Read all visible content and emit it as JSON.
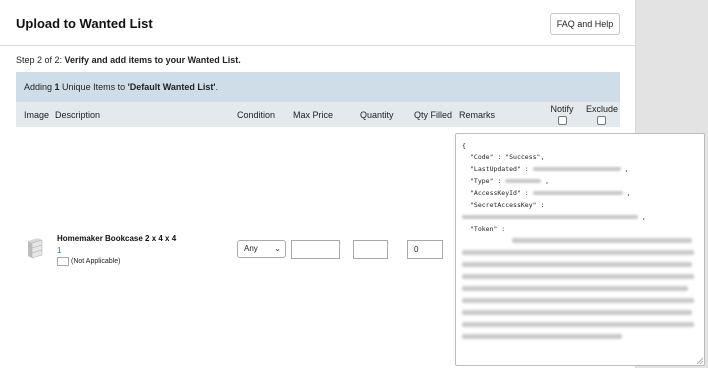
{
  "header": {
    "title": "Upload to Wanted List",
    "faq_button": "FAQ and Help"
  },
  "step": {
    "prefix": "Step 2 of 2: ",
    "bold": "Verify and add items to your Wanted List."
  },
  "adding": {
    "prefix": "Adding ",
    "count": "1",
    "middle": " Unique Items to ",
    "list_name": "'Default Wanted List'",
    "suffix": "."
  },
  "columns": {
    "image": "Image",
    "description": "Description",
    "condition": "Condition",
    "max_price": "Max Price",
    "quantity": "Quantity",
    "qty_filled": "Qty Filled",
    "remarks": "Remarks",
    "notify": "Notify",
    "exclude": "Exclude"
  },
  "item": {
    "name": "Homemaker Bookcase 2 x 4 x 4",
    "quantity_link": "1",
    "not_applicable": "(Not Applicable)",
    "condition": "Any",
    "max_price": "",
    "quantity": "",
    "qty_filled": "0"
  },
  "json_popup": {
    "open_brace": "{",
    "code_line": "\"Code\" : \"Success\",",
    "last_updated_key": "\"LastUpdated\" :",
    "type_key": "\"Type\" :",
    "access_key_key": "\"AccessKeyId\" :",
    "secret_key_key": "\"SecretAccessKey\" :",
    "token_key": "\"Token\" :"
  },
  "colors": {
    "adding_bar": "#cfdde8",
    "header_row": "#e4e9ed",
    "link": "#2a6ebb"
  }
}
